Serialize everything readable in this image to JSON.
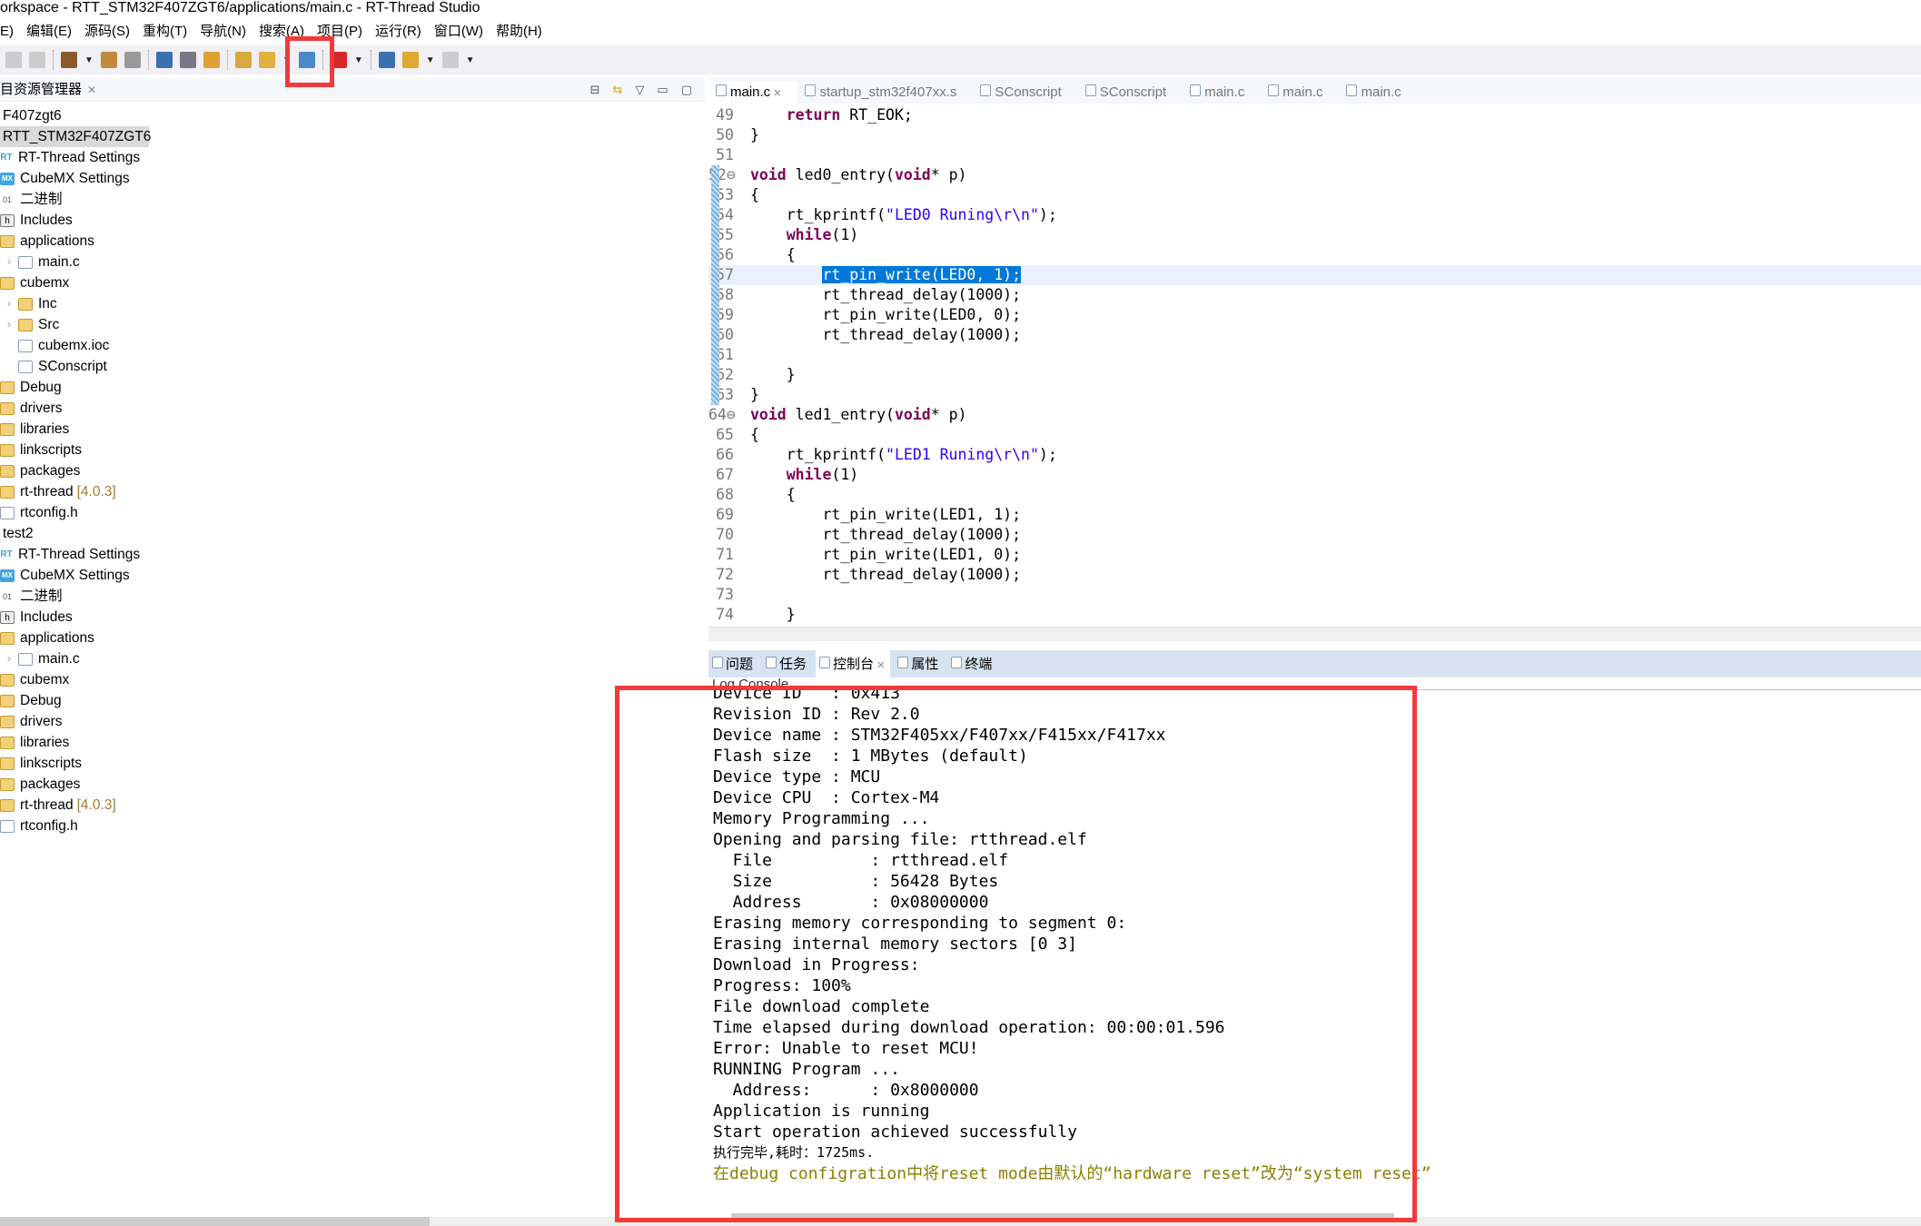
{
  "window": {
    "title": "orkspace - RTT_STM32F407ZGT6/applications/main.c - RT-Thread Studio"
  },
  "menu": [
    "E)",
    "编辑(E)",
    "源码(S)",
    "重构(T)",
    "导航(N)",
    "搜索(A)",
    "项目(P)",
    "运行(R)",
    "窗口(W)",
    "帮助(H)"
  ],
  "toolbar": {
    "icons": [
      "save-icon",
      "save-all-icon",
      "build-hammer-icon",
      "clean-icon",
      "settings-wrench-icon",
      "terminal-icon",
      "sdk-manager-icon",
      "debug-bug-icon",
      "open-project-icon",
      "new-icon",
      "book-icon",
      "download-icon",
      "memory-icon",
      "back-arrow-icon",
      "forward-arrow-icon"
    ]
  },
  "explorer": {
    "title": "目资源管理器",
    "items": [
      {
        "label": "F407zgt6",
        "lvl": 0,
        "icon": "none"
      },
      {
        "label": "RTT_STM32F407ZGT6",
        "lvl": 0,
        "icon": "none",
        "selected": true
      },
      {
        "label": "RT-Thread Settings",
        "lvl": 0,
        "icon": "rt"
      },
      {
        "label": "CubeMX Settings",
        "lvl": 0,
        "icon": "mx"
      },
      {
        "label": "二进制",
        "lvl": 0,
        "icon": "bin"
      },
      {
        "label": "Includes",
        "lvl": 0,
        "icon": "inc"
      },
      {
        "label": "applications",
        "lvl": 0,
        "icon": "folder"
      },
      {
        "label": "main.c",
        "lvl": 1,
        "icon": "file",
        "arrow": true
      },
      {
        "label": "cubemx",
        "lvl": 0,
        "icon": "folder"
      },
      {
        "label": "Inc",
        "lvl": 1,
        "icon": "folder",
        "arrow": true
      },
      {
        "label": "Src",
        "lvl": 1,
        "icon": "folder",
        "arrow": true
      },
      {
        "label": "cubemx.ioc",
        "lvl": 1,
        "icon": "file"
      },
      {
        "label": "SConscript",
        "lvl": 1,
        "icon": "file"
      },
      {
        "label": "Debug",
        "lvl": 0,
        "icon": "folder"
      },
      {
        "label": "drivers",
        "lvl": 0,
        "icon": "folder"
      },
      {
        "label": "libraries",
        "lvl": 0,
        "icon": "folder"
      },
      {
        "label": "linkscripts",
        "lvl": 0,
        "icon": "folder"
      },
      {
        "label": "packages",
        "lvl": 0,
        "icon": "folder"
      },
      {
        "label": "rt-thread",
        "lvl": 0,
        "icon": "folder",
        "version": "[4.0.3]"
      },
      {
        "label": "rtconfig.h",
        "lvl": 0,
        "icon": "file"
      },
      {
        "label": "test2",
        "lvl": 0,
        "icon": "none"
      },
      {
        "label": "RT-Thread Settings",
        "lvl": 0,
        "icon": "rt"
      },
      {
        "label": "CubeMX Settings",
        "lvl": 0,
        "icon": "mx"
      },
      {
        "label": "二进制",
        "lvl": 0,
        "icon": "bin"
      },
      {
        "label": "Includes",
        "lvl": 0,
        "icon": "inc"
      },
      {
        "label": "applications",
        "lvl": 0,
        "icon": "folder"
      },
      {
        "label": "main.c",
        "lvl": 1,
        "icon": "file",
        "arrow": true
      },
      {
        "label": "cubemx",
        "lvl": 0,
        "icon": "folder"
      },
      {
        "label": "Debug",
        "lvl": 0,
        "icon": "folder"
      },
      {
        "label": "drivers",
        "lvl": 0,
        "icon": "folder"
      },
      {
        "label": "libraries",
        "lvl": 0,
        "icon": "folder"
      },
      {
        "label": "linkscripts",
        "lvl": 0,
        "icon": "folder"
      },
      {
        "label": "packages",
        "lvl": 0,
        "icon": "folder"
      },
      {
        "label": "rt-thread",
        "lvl": 0,
        "icon": "folder",
        "version": "[4.0.3]"
      },
      {
        "label": "rtconfig.h",
        "lvl": 0,
        "icon": "file"
      }
    ]
  },
  "editor": {
    "tabs": [
      "main.c",
      "startup_stm32f407xx.s",
      "SConscript",
      "SConscript",
      "main.c",
      "main.c",
      "main.c"
    ],
    "active_tab": 0,
    "lines": [
      {
        "n": "49",
        "parts": [
          [
            "    ",
            ""
          ],
          [
            "return",
            "kw"
          ],
          [
            " RT_EOK;",
            ""
          ]
        ]
      },
      {
        "n": "50",
        "parts": [
          [
            "}",
            ""
          ]
        ]
      },
      {
        "n": "51",
        "parts": []
      },
      {
        "n": "52⊖",
        "parts": [
          [
            "void",
            "kw"
          ],
          [
            " led0_entry(",
            ""
          ],
          [
            "void",
            "kw"
          ],
          [
            "* p)",
            ""
          ]
        ],
        "marker": true
      },
      {
        "n": "53",
        "parts": [
          [
            "{",
            ""
          ]
        ],
        "marker": true
      },
      {
        "n": "54",
        "parts": [
          [
            "    rt_kprintf(",
            ""
          ],
          [
            "\"LED0 Runing\\r\\n\"",
            "str"
          ],
          [
            ");",
            ""
          ]
        ],
        "marker": true
      },
      {
        "n": "55",
        "parts": [
          [
            "    ",
            ""
          ],
          [
            "while",
            "kw"
          ],
          [
            "(1)",
            ""
          ]
        ],
        "marker": true
      },
      {
        "n": "56",
        "parts": [
          [
            "    {",
            ""
          ]
        ],
        "marker": true
      },
      {
        "n": "57",
        "parts": [
          [
            "        ",
            ""
          ],
          [
            "rt_pin_write(LED0, 1);",
            "hl"
          ]
        ],
        "marker": true,
        "current": true
      },
      {
        "n": "58",
        "parts": [
          [
            "        rt_thread_delay(1000);",
            ""
          ]
        ],
        "marker": true
      },
      {
        "n": "59",
        "parts": [
          [
            "        rt_pin_write(LED0, 0);",
            ""
          ]
        ],
        "marker": true
      },
      {
        "n": "60",
        "parts": [
          [
            "        rt_thread_delay(1000);",
            ""
          ]
        ],
        "marker": true
      },
      {
        "n": "61",
        "parts": [],
        "marker": true
      },
      {
        "n": "62",
        "parts": [
          [
            "    }",
            ""
          ]
        ],
        "marker": true
      },
      {
        "n": "63",
        "parts": [
          [
            "}",
            ""
          ]
        ],
        "marker": true
      },
      {
        "n": "64⊖",
        "parts": [
          [
            "void",
            "kw"
          ],
          [
            " led1_entry(",
            ""
          ],
          [
            "void",
            "kw"
          ],
          [
            "* p)",
            ""
          ]
        ]
      },
      {
        "n": "65",
        "parts": [
          [
            "{",
            ""
          ]
        ]
      },
      {
        "n": "66",
        "parts": [
          [
            "    rt_kprintf(",
            ""
          ],
          [
            "\"LED1 Runing\\r\\n\"",
            "str"
          ],
          [
            ");",
            ""
          ]
        ]
      },
      {
        "n": "67",
        "parts": [
          [
            "    ",
            ""
          ],
          [
            "while",
            "kw"
          ],
          [
            "(1)",
            ""
          ]
        ]
      },
      {
        "n": "68",
        "parts": [
          [
            "    {",
            ""
          ]
        ]
      },
      {
        "n": "69",
        "parts": [
          [
            "        rt_pin_write(LED1, 1);",
            ""
          ]
        ]
      },
      {
        "n": "70",
        "parts": [
          [
            "        rt_thread_delay(1000);",
            ""
          ]
        ]
      },
      {
        "n": "71",
        "parts": [
          [
            "        rt_pin_write(LED1, 0);",
            ""
          ]
        ]
      },
      {
        "n": "72",
        "parts": [
          [
            "        rt_thread_delay(1000);",
            ""
          ]
        ]
      },
      {
        "n": "73",
        "parts": []
      },
      {
        "n": "74",
        "parts": [
          [
            "    }",
            ""
          ]
        ]
      }
    ]
  },
  "bottom": {
    "tabs": [
      "问题",
      "任务",
      "控制台",
      "属性",
      "终端"
    ],
    "active_tab": 2,
    "console_title": "Log Console",
    "lines": [
      "Device ID   : 0x413",
      "Revision ID : Rev 2.0",
      "Device name : STM32F405xx/F407xx/F415xx/F417xx",
      "Flash size  : 1 MBytes (default)",
      "Device type : MCU",
      "Device CPU  : Cortex-M4",
      "Memory Programming ...",
      "Opening and parsing file: rtthread.elf",
      "  File          : rtthread.elf",
      "  Size          : 56428 Bytes",
      "  Address       : 0x08000000",
      "Erasing memory corresponding to segment 0:",
      "Erasing internal memory sectors [0 3]",
      "Download in Progress:",
      "Progress: 100%",
      "File download complete",
      "Time elapsed during download operation: 00:00:01.596",
      "Error: Unable to reset MCU!",
      "RUNNING Program ...",
      "  Address:      : 0x8000000",
      "Application is running",
      "Start operation achieved successfully"
    ],
    "done_line": "执行完毕,耗时：1725ms.",
    "note_line": "在debug configration中将reset mode由默认的“hardware reset”改为“system reset”"
  },
  "colors": {
    "annotation_red": "#f23a3a",
    "keyword": "#7f0055",
    "string": "#2a00ff",
    "selection": "#0078d7",
    "note": "#8a8000"
  }
}
